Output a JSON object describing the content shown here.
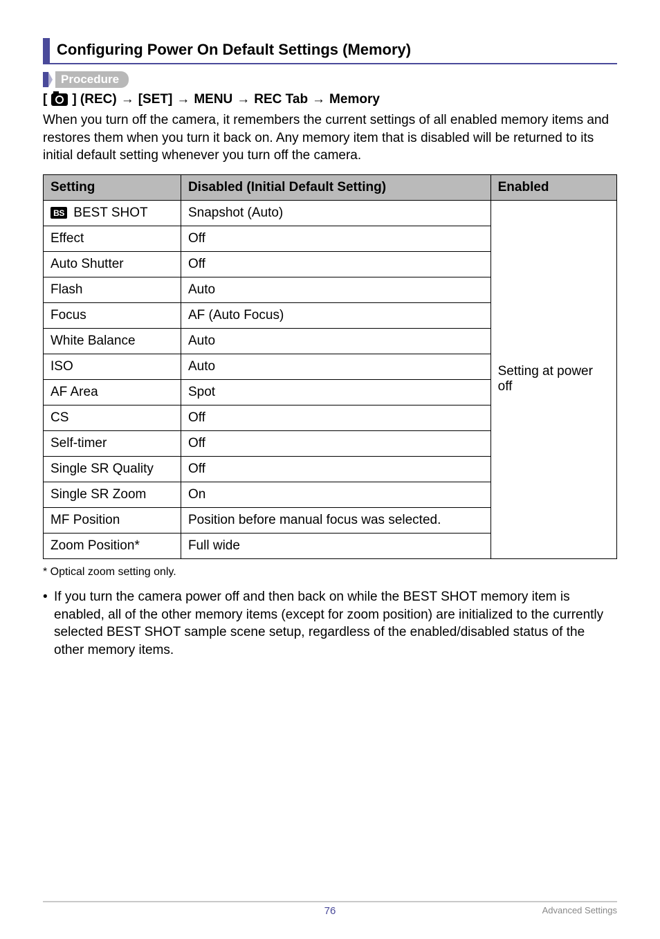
{
  "heading": "Configuring Power On Default Settings (Memory)",
  "procedure_label": "Procedure",
  "path": {
    "p1_prefix": "[",
    "p1_suffix": "] (REC)",
    "p2": "[SET]",
    "p3": "MENU",
    "p4": "REC Tab",
    "p5": "Memory"
  },
  "intro": "When you turn off the camera, it remembers the current settings of all enabled memory items and restores them when you turn it back on. Any memory item that is disabled will be returned to its initial default setting whenever you turn off the camera.",
  "table": {
    "headers": {
      "setting": "Setting",
      "disabled": "Disabled (Initial Default Setting)",
      "enabled": "Enabled"
    },
    "rows": [
      {
        "setting_icon": "BS",
        "setting": "BEST SHOT",
        "disabled": "Snapshot (Auto)"
      },
      {
        "setting": "Effect",
        "disabled": "Off"
      },
      {
        "setting": "Auto Shutter",
        "disabled": "Off"
      },
      {
        "setting": "Flash",
        "disabled": "Auto"
      },
      {
        "setting": "Focus",
        "disabled": "AF (Auto Focus)"
      },
      {
        "setting": "White Balance",
        "disabled": "Auto"
      },
      {
        "setting": "ISO",
        "disabled": "Auto"
      },
      {
        "setting": "AF Area",
        "disabled": "Spot"
      },
      {
        "setting": "CS",
        "disabled": "Off"
      },
      {
        "setting": "Self-timer",
        "disabled": "Off"
      },
      {
        "setting": "Single SR Quality",
        "disabled": "Off"
      },
      {
        "setting": "Single SR Zoom",
        "disabled": "On"
      },
      {
        "setting": "MF Position",
        "disabled": "Position before manual focus was selected."
      },
      {
        "setting": "Zoom Position*",
        "disabled": "Full wide"
      }
    ],
    "enabled_value": "Setting at power off"
  },
  "footnote": "* Optical zoom setting only.",
  "bullet": "If you turn the camera power off and then back on while the BEST SHOT memory item is enabled, all of the other memory items (except for zoom position) are initialized to the currently selected BEST SHOT sample scene setup, regardless of the enabled/disabled status of the other memory items.",
  "footer": {
    "page": "76",
    "section": "Advanced Settings"
  }
}
